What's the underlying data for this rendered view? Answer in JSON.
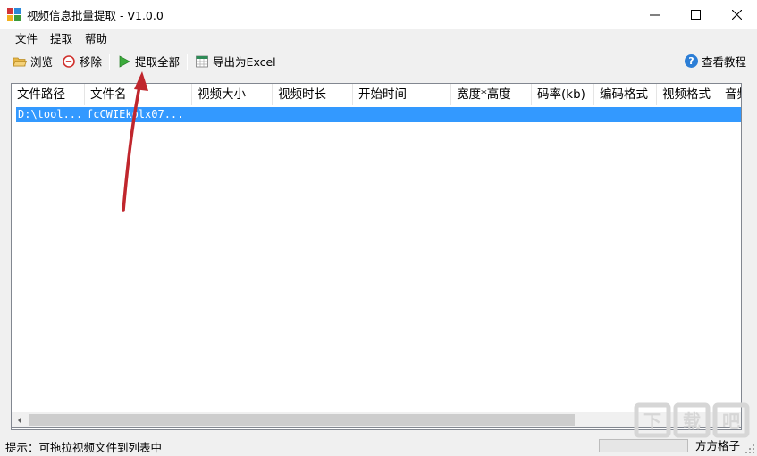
{
  "window": {
    "title": "视频信息批量提取 - V1.0.0",
    "minimize_glyph": "—",
    "maximize_glyph": "☐",
    "close_glyph": "✕"
  },
  "menu": {
    "items": [
      "文件",
      "提取",
      "帮助"
    ]
  },
  "toolbar": {
    "browse_label": "浏览",
    "browse_icon": "folder-icon",
    "remove_label": "移除",
    "remove_icon": "remove-circle-icon",
    "extract_all_label": "提取全部",
    "extract_all_icon": "play-icon",
    "export_label": "导出为Excel",
    "export_icon": "excel-icon",
    "tutorial_label": "查看教程",
    "tutorial_icon": "help-icon",
    "tutorial_glyph": "?"
  },
  "table": {
    "columns": [
      "文件路径",
      "文件名",
      "视频大小",
      "视频时长",
      "开始时间",
      "宽度*高度",
      "码率(kb)",
      "编码格式",
      "视频格式",
      "音频"
    ],
    "rows": [
      {
        "path": "D:\\tool...",
        "name": "fcCWIEkolx07..."
      }
    ]
  },
  "status": {
    "hint": "提示：可拖拉视频文件到列表中",
    "author": "方方格子"
  },
  "watermark": {
    "text": "下载吧"
  },
  "colors": {
    "selection": "#3399ff",
    "annotation_arrow": "#c0262d",
    "help_icon": "#2c7ed6"
  }
}
